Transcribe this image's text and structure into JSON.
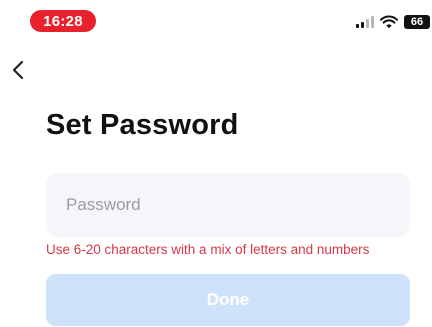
{
  "status_bar": {
    "time": "16:28",
    "battery": "66",
    "colors": {
      "time_pill": "#e8222d"
    }
  },
  "nav": {
    "back_icon": "chevron-left-icon"
  },
  "page": {
    "title": "Set Password"
  },
  "form": {
    "password_placeholder": "Password",
    "password_value": "",
    "hint": "Use 6-20 characters with a mix of letters and numbers",
    "done_label": "Done",
    "done_enabled": false
  },
  "colors": {
    "hint": "#d7364a",
    "done_disabled_bg": "#cfe2fc",
    "input_bg": "#f5f6fa"
  }
}
